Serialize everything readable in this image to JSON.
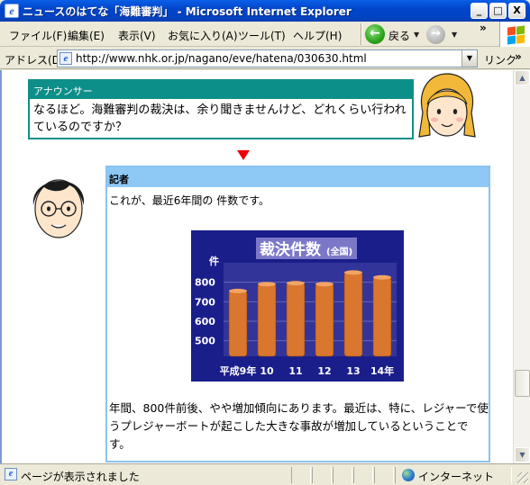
{
  "window": {
    "title": "ニュースのはてな「海難審判」 - Microsoft Internet Explorer",
    "minimize": "_",
    "maximize": "□",
    "close": "X"
  },
  "menu": {
    "items": [
      "ファイル(F)",
      "編集(E)",
      "表示(V)",
      "お気に入り(A)",
      "ツール(T)",
      "ヘルプ(H)"
    ],
    "back_label": "戻る",
    "more": "»"
  },
  "address": {
    "label": "アドレス(D)",
    "url": "http://www.nhk.or.jp/nagano/eve/hatena/030630.html",
    "links_label": "リンク",
    "links_more": "»"
  },
  "dialogue": {
    "announcer": {
      "speaker": "アナウンサー",
      "text": "なるほど。海難審判の裁決は、余り聞きませんけど、どれくらい行われているのですか？"
    },
    "reporter": {
      "speaker": "記者",
      "intro": "これが、最近6年間の 件数です。",
      "summary": "年間、800件前後、やや増加傾向にあります。最近は、特に、レジャーで使うプレジャーボートが起こした大きな事故が増加しているということです。"
    }
  },
  "chart_data": {
    "type": "bar",
    "title": "裁決件数",
    "subtitle": "(全国)",
    "ylabel": "件",
    "categories": [
      "平成9年",
      "10",
      "11",
      "12",
      "13",
      "14年"
    ],
    "values": [
      755,
      790,
      795,
      790,
      850,
      825
    ],
    "ylim": [
      420,
      900
    ],
    "yticks": [
      500,
      600,
      700,
      800
    ],
    "colors": {
      "background": "#1a1e8a",
      "title_panel": "#7b78c8",
      "bar": "#d9772e",
      "text": "#ffffff"
    }
  },
  "status": {
    "text": "ページが表示されました",
    "zone": "インターネット"
  }
}
